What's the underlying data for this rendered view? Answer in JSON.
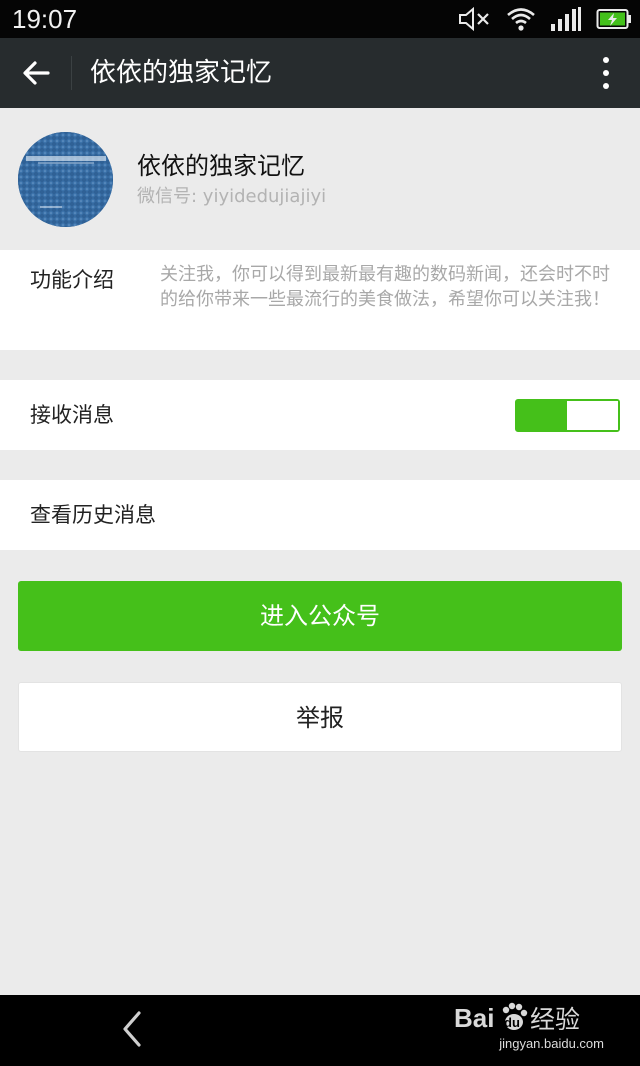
{
  "status_bar": {
    "time": "19:07",
    "icons": [
      "volume-muted-icon",
      "wifi-icon",
      "signal-icon",
      "battery-charging-icon"
    ]
  },
  "header": {
    "title": "依依的独家记忆",
    "back_icon": "arrow-left-icon",
    "more_icon": "more-vertical-icon"
  },
  "profile": {
    "name": "依依的独家记忆",
    "wechat_id": "微信号: yiyidedujiajiyi"
  },
  "intro": {
    "label": "功能介绍",
    "text": "关注我，你可以得到最新最有趣的数码新闻，还会时不时的给你带来一些最流行的美食做法，希望你可以关注我！"
  },
  "settings": {
    "receive_label": "接收消息",
    "receive_enabled": true,
    "history_label": "查看历史消息"
  },
  "buttons": {
    "enter": "进入公众号",
    "report": "举报"
  },
  "colors": {
    "accent_green": "#45c01a",
    "action_bar": "#272c2e",
    "page_background": "#ebebeb"
  },
  "watermark": {
    "brand": "Bai 经验",
    "url": "jingyan.baidu.com"
  }
}
